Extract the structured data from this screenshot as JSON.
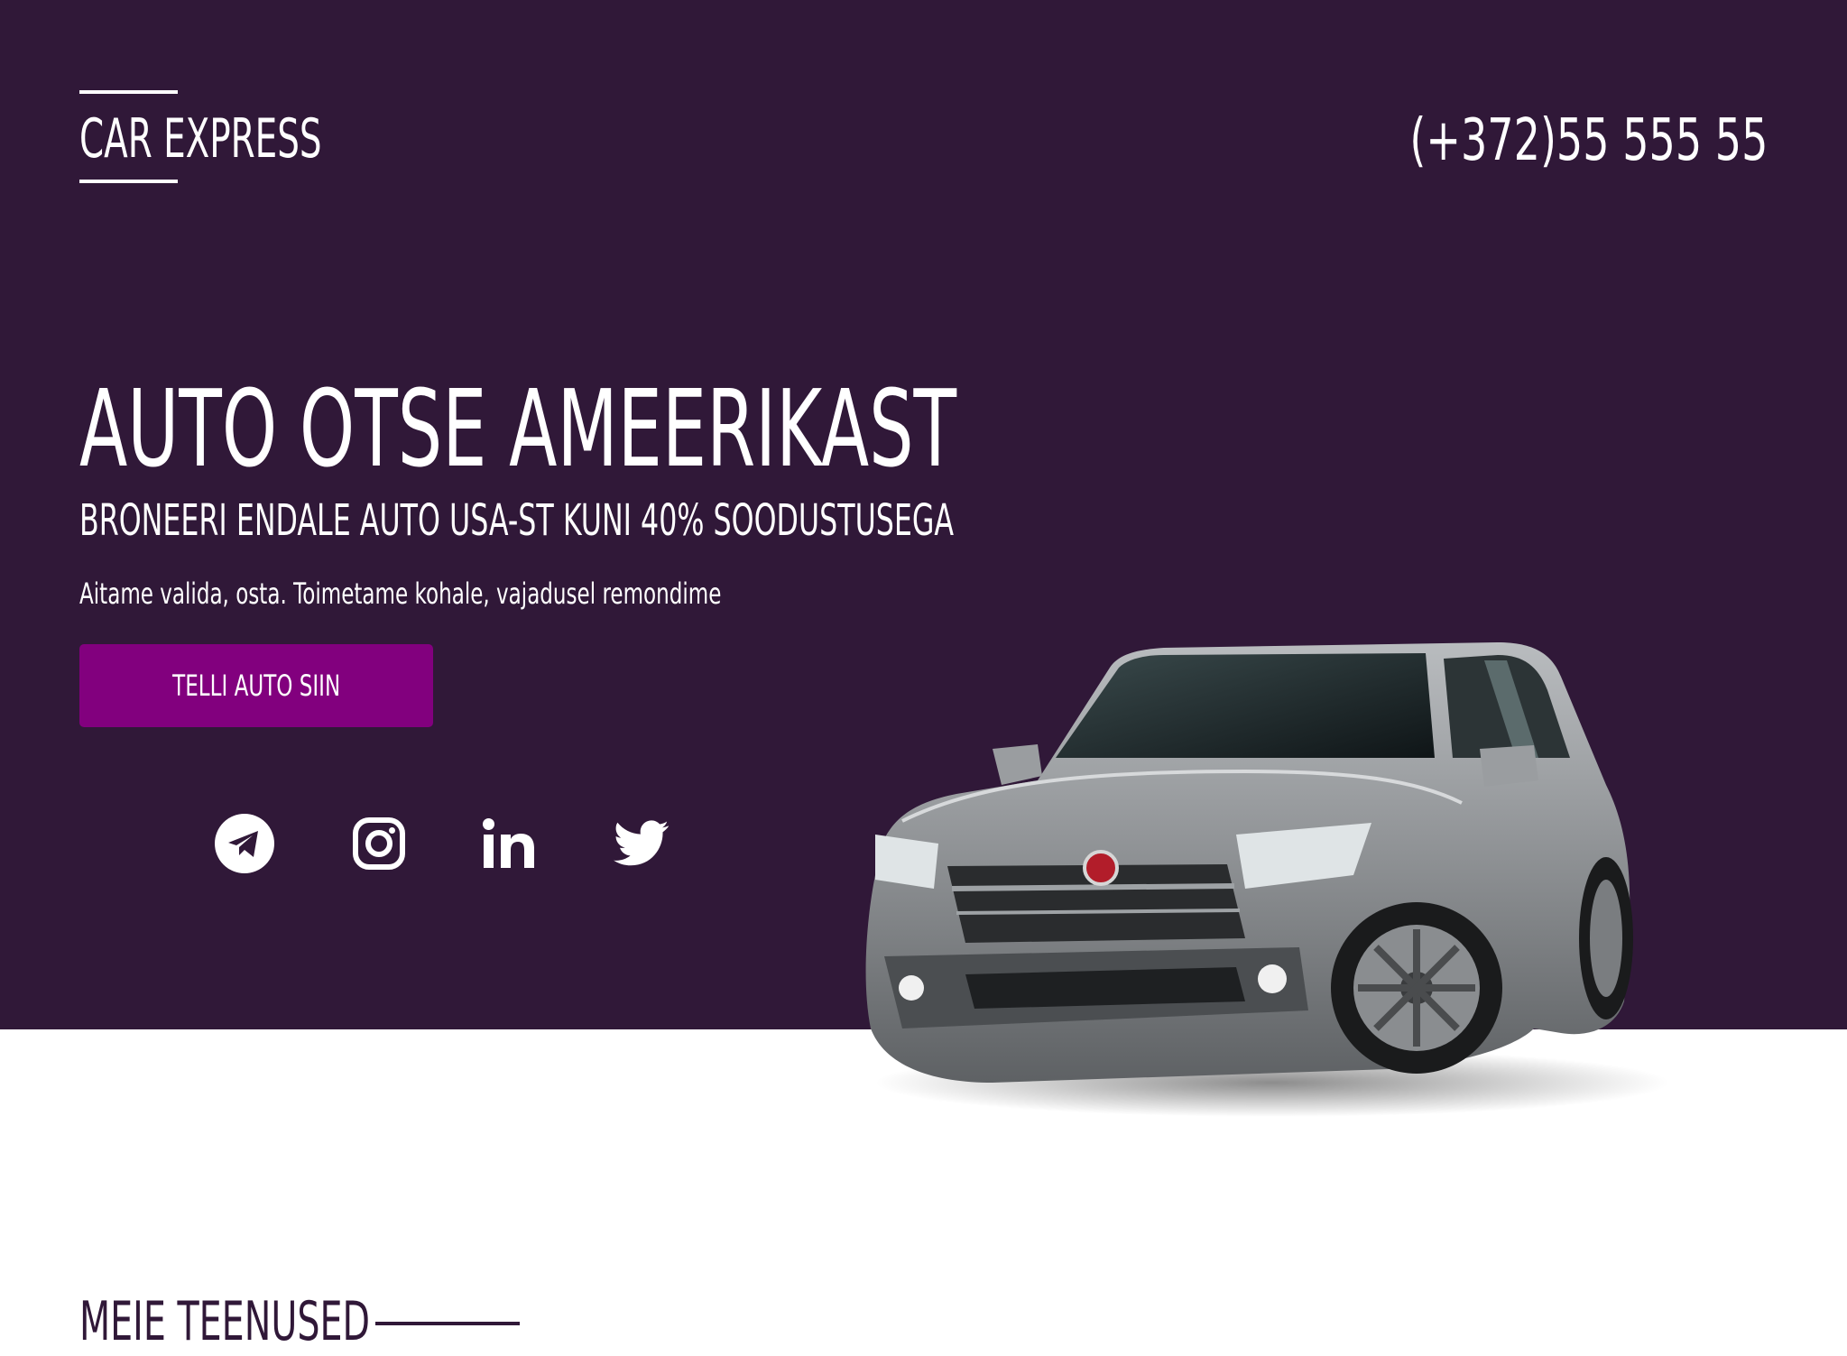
{
  "header": {
    "logo_text": "CAR EXPRESS",
    "phone": "(+372)55 555 55"
  },
  "hero": {
    "title": "AUTO OTSE AMEERIKAST",
    "subtitle": "BRONEERI ENDALE AUTO USA-ST KUNI 40% SOODUSTUSEGA",
    "tagline": "Aitame valida, osta. Toimetame kohale, vajadusel remondime",
    "cta_label": "TELLI AUTO SIIN"
  },
  "social": [
    {
      "icon": "telegram-icon"
    },
    {
      "icon": "instagram-icon"
    },
    {
      "icon": "linkedin-icon"
    },
    {
      "icon": "twitter-icon"
    }
  ],
  "services": {
    "heading": "MEIE TEENUSED"
  },
  "colors": {
    "hero_background": "#301838",
    "button": "#82007e",
    "text_light": "#ffffff",
    "heading_dark": "#301838"
  }
}
